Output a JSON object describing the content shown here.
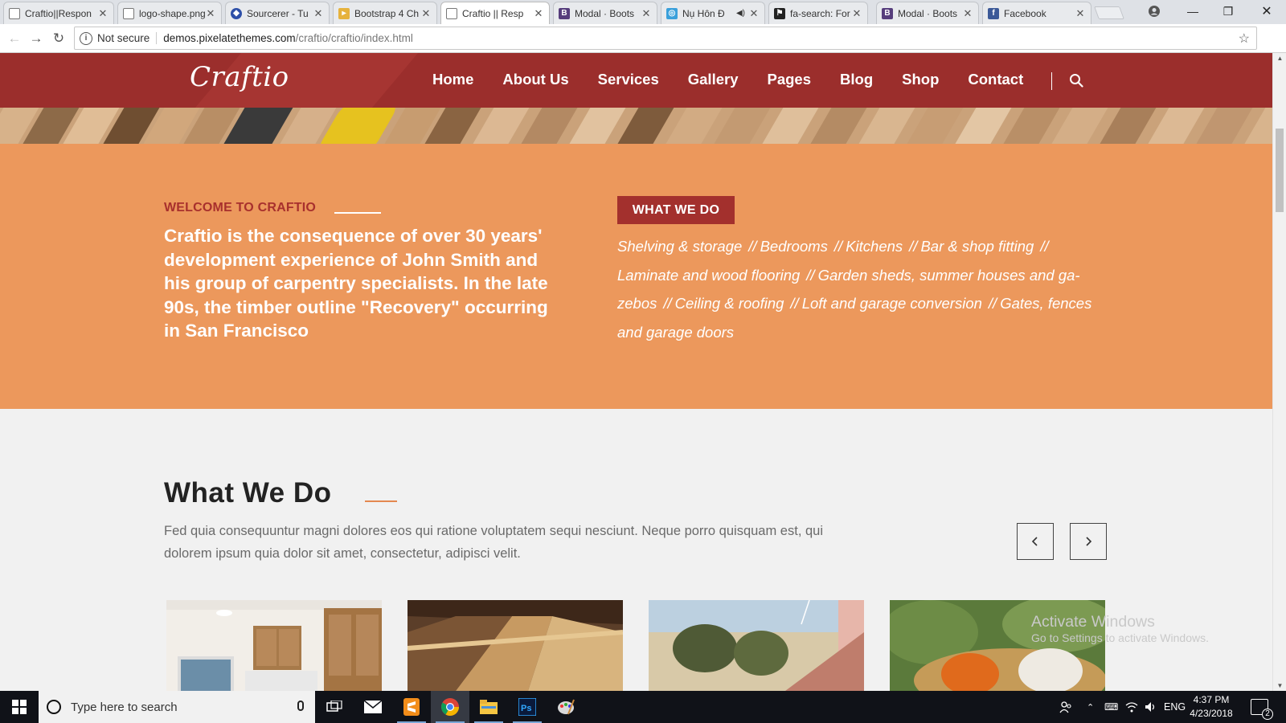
{
  "browser": {
    "tabs": [
      {
        "title": "Craftio||Respon",
        "icon": "page-icon"
      },
      {
        "title": "logo-shape.png",
        "icon": "page-icon"
      },
      {
        "title": "Sourcerer - Tu",
        "icon": "sourcerer-icon"
      },
      {
        "title": "Bootstrap 4 Ch",
        "icon": "bootstrap-icon"
      },
      {
        "title": "Craftio || Resp",
        "icon": "page-icon"
      },
      {
        "title": "Modal · Boots",
        "icon": "bootstrap-icon"
      },
      {
        "title": "Nụ Hôn Đ",
        "icon": "zing-icon"
      },
      {
        "title": "fa-search: For",
        "icon": "fontawesome-icon"
      },
      {
        "title": "Modal · Boots",
        "icon": "bootstrap-icon"
      },
      {
        "title": "Facebook",
        "icon": "facebook-icon"
      }
    ],
    "active_tab": 4,
    "security_label": "Not secure",
    "url_domain": "demos.pixelatethemes.com",
    "url_path": "/craftio/craftio/index.html"
  },
  "site": {
    "logo": "Craftio",
    "nav": [
      "Home",
      "About Us",
      "Services",
      "Gallery",
      "Pages",
      "Blog",
      "Shop",
      "Contact"
    ],
    "colors": {
      "header": "#9b2e2c",
      "band": "#ec985c",
      "accent": "#a3302d"
    }
  },
  "intro": {
    "welcome_label": "WELCOME TO CRAFTIO",
    "text": "Craftio is the consequence of over 30 years' development experience of John Smith and his group of carpentry specialists. In the late 90s, the timber outline \"Recovery\" occurring in San Francisco"
  },
  "what_we_do_box": {
    "badge": "WHAT WE DO",
    "separator": "//",
    "services": [
      "Shelving & storage",
      "Bedrooms",
      "Kitchens",
      "Bar & shop fitting",
      "Laminate and wood flooring",
      "Garden sheds, summer houses and ga-zebos",
      "Ceiling & roofing",
      "Loft and garage conversion",
      "Gates, fences and garage doors"
    ]
  },
  "section": {
    "title": "What We Do",
    "description": "Fed quia consequuntur magni dolores eos qui ratione voluptatem sequi nesciunt. Neque porro quisquam est, qui dolorem ipsum quia dolor sit amet, consectetur, adipisci velit.",
    "prev_icon": "chevron-left-icon",
    "next_icon": "chevron-right-icon"
  },
  "watermark": {
    "line1": "Activate Windows",
    "line2": "Go to Settings to activate Windows."
  },
  "taskbar": {
    "search_placeholder": "Type here to search",
    "language": "ENG",
    "time": "4:37 PM",
    "date": "4/23/2018",
    "notifications": "2"
  }
}
